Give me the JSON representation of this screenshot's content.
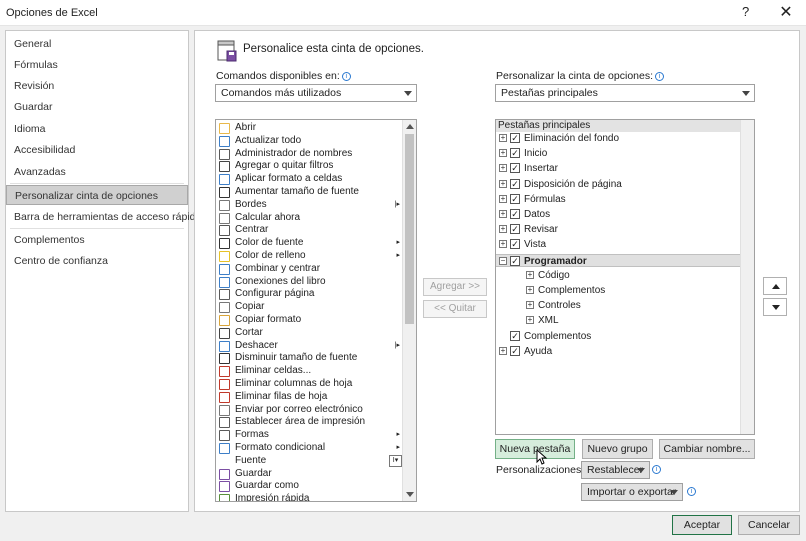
{
  "window": {
    "title": "Opciones de Excel",
    "help": "?",
    "close": "✕"
  },
  "nav": {
    "items": [
      {
        "label": "General",
        "selected": false
      },
      {
        "label": "Fórmulas",
        "selected": false
      },
      {
        "label": "Revisión",
        "selected": false
      },
      {
        "label": "Guardar",
        "selected": false
      },
      {
        "label": "Idioma",
        "selected": false
      },
      {
        "label": "Accesibilidad",
        "selected": false
      },
      {
        "label": "Avanzadas",
        "selected": false
      },
      {
        "label": "Personalizar cinta de opciones",
        "selected": true
      },
      {
        "label": "Barra de herramientas de acceso rápido",
        "selected": false
      },
      {
        "label": "Complementos",
        "selected": false
      },
      {
        "label": "Centro de confianza",
        "selected": false
      }
    ]
  },
  "header": {
    "title": "Personalice esta cinta de opciones."
  },
  "left": {
    "label": "Comandos disponibles en:",
    "info": "i",
    "combo": "Comandos más utilizados",
    "commands": [
      {
        "label": "Abrir",
        "icon": "folder-icon"
      },
      {
        "label": "Actualizar todo",
        "icon": "refresh-icon"
      },
      {
        "label": "Administrador de nombres",
        "icon": "name-manager-icon"
      },
      {
        "label": "Agregar o quitar filtros",
        "icon": "filter-icon"
      },
      {
        "label": "Aplicar formato a celdas",
        "icon": "format-cells-icon"
      },
      {
        "label": "Aumentar tamaño de fuente",
        "icon": "font-grow-icon"
      },
      {
        "label": "Bordes",
        "icon": "borders-icon",
        "sub": "separator"
      },
      {
        "label": "Calcular ahora",
        "icon": "calculator-icon"
      },
      {
        "label": "Centrar",
        "icon": "align-center-icon"
      },
      {
        "label": "Color de fuente",
        "icon": "font-color-icon",
        "sub": "arrow"
      },
      {
        "label": "Color de relleno",
        "icon": "fill-color-icon",
        "sub": "arrow"
      },
      {
        "label": "Combinar y centrar",
        "icon": "merge-center-icon"
      },
      {
        "label": "Conexiones del libro",
        "icon": "connections-icon"
      },
      {
        "label": "Configurar página",
        "icon": "page-setup-icon"
      },
      {
        "label": "Copiar",
        "icon": "copy-icon"
      },
      {
        "label": "Copiar formato",
        "icon": "format-painter-icon"
      },
      {
        "label": "Cortar",
        "icon": "scissors-icon"
      },
      {
        "label": "Deshacer",
        "icon": "undo-icon",
        "sub": "separator"
      },
      {
        "label": "Disminuir tamaño de fuente",
        "icon": "font-shrink-icon"
      },
      {
        "label": "Eliminar celdas...",
        "icon": "delete-cells-icon"
      },
      {
        "label": "Eliminar columnas de hoja",
        "icon": "delete-columns-icon"
      },
      {
        "label": "Eliminar filas de hoja",
        "icon": "delete-rows-icon"
      },
      {
        "label": "Enviar por correo electrónico",
        "icon": "email-icon"
      },
      {
        "label": "Establecer área de impresión",
        "icon": "print-area-icon"
      },
      {
        "label": "Formas",
        "icon": "shapes-icon",
        "sub": "arrow"
      },
      {
        "label": "Formato condicional",
        "icon": "conditional-format-icon",
        "sub": "arrow"
      },
      {
        "label": "Fuente",
        "icon": "",
        "sub": "box"
      },
      {
        "label": "Guardar",
        "icon": "save-icon"
      },
      {
        "label": "Guardar como",
        "icon": "save-as-icon"
      },
      {
        "label": "Impresión rápida",
        "icon": "quick-print-icon"
      }
    ]
  },
  "middle": {
    "add": "Agregar >>",
    "remove": "<< Quitar"
  },
  "right": {
    "label": "Personalizar la cinta de opciones:",
    "info": "i",
    "combo": "Pestañas principales",
    "tree_header": "Pestañas principales",
    "nodes": [
      {
        "label": "Eliminación del fondo",
        "level": 0,
        "expander": "+",
        "checked": true
      },
      {
        "label": "Inicio",
        "level": 0,
        "expander": "+",
        "checked": true
      },
      {
        "label": "Insertar",
        "level": 0,
        "expander": "+",
        "checked": true
      },
      {
        "label": "Disposición de página",
        "level": 0,
        "expander": "+",
        "checked": true
      },
      {
        "label": "Fórmulas",
        "level": 0,
        "expander": "+",
        "checked": true
      },
      {
        "label": "Datos",
        "level": 0,
        "expander": "+",
        "checked": true
      },
      {
        "label": "Revisar",
        "level": 0,
        "expander": "+",
        "checked": true
      },
      {
        "label": "Vista",
        "level": 0,
        "expander": "+",
        "checked": true
      },
      {
        "label": "Programador",
        "level": 0,
        "expander": "−",
        "checked": true,
        "selected": true
      },
      {
        "label": "Código",
        "level": 1,
        "expander": "+"
      },
      {
        "label": "Complementos",
        "level": 1,
        "expander": "+"
      },
      {
        "label": "Controles",
        "level": 1,
        "expander": "+"
      },
      {
        "label": "XML",
        "level": 1,
        "expander": "+"
      },
      {
        "label": "Complementos",
        "level": 0,
        "expander": "",
        "checked": true
      },
      {
        "label": "Ayuda",
        "level": 0,
        "expander": "+",
        "checked": true
      }
    ],
    "new_tab": "Nueva pestaña",
    "new_group": "Nuevo grupo",
    "rename": "Cambiar nombre...",
    "customizations_label": "Personalizaciones:",
    "reset": "Restablecer",
    "import_export": "Importar o exportar"
  },
  "footer": {
    "ok": "Aceptar",
    "cancel": "Cancelar"
  }
}
